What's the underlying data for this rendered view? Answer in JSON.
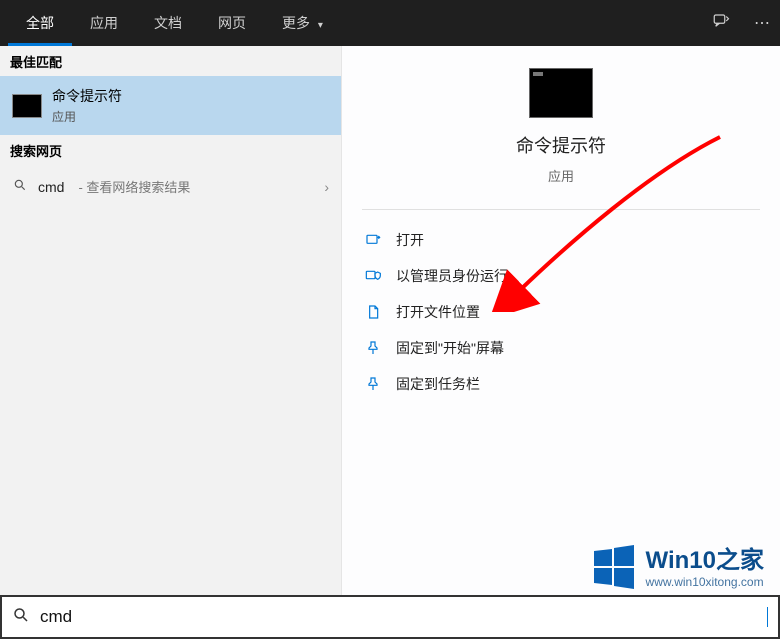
{
  "topbar": {
    "tabs": {
      "all": "全部",
      "apps": "应用",
      "docs": "文档",
      "web": "网页",
      "more": "更多"
    }
  },
  "left": {
    "best_match_header": "最佳匹配",
    "best_match": {
      "title": "命令提示符",
      "subtitle": "应用"
    },
    "web_header": "搜索网页",
    "web_row": {
      "term": "cmd",
      "hint": "- 查看网络搜索结果"
    }
  },
  "right": {
    "title": "命令提示符",
    "subtitle": "应用",
    "actions": {
      "open": "打开",
      "run_admin": "以管理员身份运行",
      "open_location": "打开文件位置",
      "pin_start": "固定到\"开始\"屏幕",
      "pin_taskbar": "固定到任务栏"
    }
  },
  "search": {
    "value": "cmd"
  },
  "watermark": {
    "brand": "Win10",
    "suffix": "之家",
    "url": "www.win10xitong.com"
  }
}
